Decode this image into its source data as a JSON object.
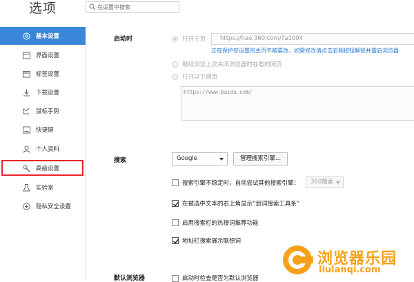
{
  "app": {
    "title": "选项"
  },
  "search": {
    "placeholder": "在设置中搜索"
  },
  "sidebar": {
    "items": [
      {
        "label": "基本设置",
        "icon": "gear-icon",
        "active": true
      },
      {
        "label": "界面设置",
        "icon": "window-icon"
      },
      {
        "label": "标签设置",
        "icon": "tabs-icon"
      },
      {
        "label": "下载设置",
        "icon": "download-icon"
      },
      {
        "label": "鼠标手势",
        "icon": "mouse-icon"
      },
      {
        "label": "快捷键",
        "icon": "keyboard-icon"
      },
      {
        "label": "个人资料",
        "icon": "user-icon"
      },
      {
        "label": "高级设置",
        "icon": "wrench-icon",
        "highlighted": true
      },
      {
        "label": "实验室",
        "icon": "lab-icon"
      },
      {
        "label": "隐私安全设置",
        "icon": "shield-icon"
      }
    ]
  },
  "startup": {
    "title": "启动时",
    "option_homepage": "打开主页",
    "homepage_url": "https://hao.360.com/?a1004",
    "warning": "正在保护您设置的主页不被篡改，如需修改请点击右侧按钮解锁并重启浏览器",
    "option_restore": "继续浏览上次关闭浏览器时在看的网页",
    "option_pages": "打开以下网页",
    "pages_text": "https://www.baidu.com/"
  },
  "search_section": {
    "title": "搜索",
    "engine_value": "Google",
    "manage_button": "管理搜索引擎...",
    "opt1_label": "搜索引擎不稳定时，自动尝试其他搜索引擎：",
    "opt1_engine": "360搜索",
    "opt2_label": "在被选中文本的右上角显示“划词搜索工具条”",
    "opt3_label": "启用搜索栏的热搜词推荐功能",
    "opt4_label": "地址栏搜索展示联想词",
    "opt1_checked": false,
    "opt2_checked": true,
    "opt3_checked": false,
    "opt4_checked": true
  },
  "default_browser": {
    "title": "默认浏览器",
    "option_label": "启动时检查是否为默认浏览器"
  },
  "watermark": {
    "cn": "浏览器乐园",
    "en": "liulanqi.com"
  },
  "colors": {
    "accent": "#3a86d8",
    "highlight": "#e8242c",
    "link": "#2a7bd3",
    "watermark": "#f6a11c"
  }
}
